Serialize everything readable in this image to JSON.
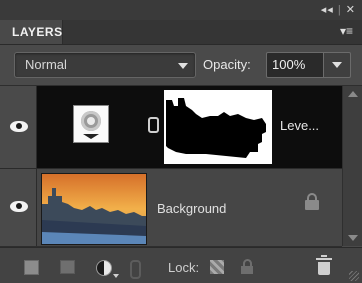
{
  "window_controls": {
    "collapse": "◂◂",
    "close": "✕"
  },
  "panel": {
    "tab_label": "LAYERS",
    "menu_icon": "panel-menu-icon"
  },
  "options": {
    "blend_mode": "Normal",
    "opacity_label": "Opacity:",
    "opacity_value": "100%"
  },
  "layers": [
    {
      "name": "Leve...",
      "type": "adjustment",
      "visible": true,
      "selected": true
    },
    {
      "name": "Background",
      "type": "image",
      "visible": true,
      "locked": true,
      "selected": false
    }
  ],
  "bottom_toolbar": {
    "lock_label": "Lock:"
  },
  "colors": {
    "panel_bg": "#4a4a4a",
    "selected_row_bg": "#0d0d0d",
    "text": "#e6e6e6"
  }
}
